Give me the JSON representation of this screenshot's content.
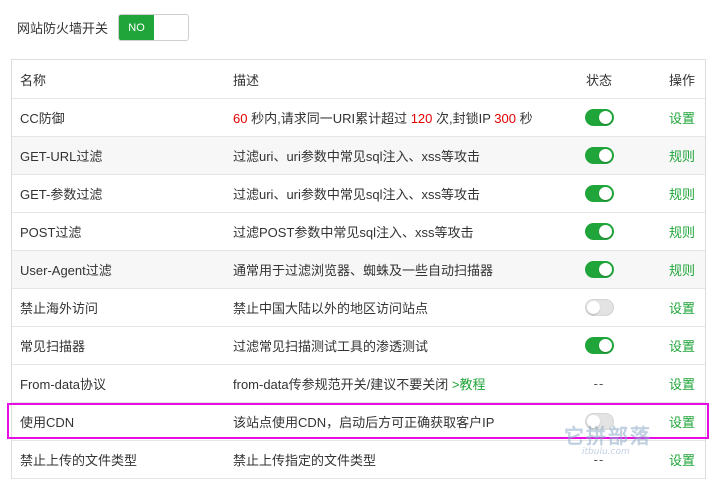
{
  "topbar": {
    "label": "网站防火墙开关",
    "switch_text": "NO"
  },
  "table": {
    "headers": {
      "name": "名称",
      "desc": "描述",
      "status": "状态",
      "action": "操作"
    },
    "rows": [
      {
        "name": "CC防御",
        "desc_parts": [
          "60",
          " 秒内,请求同一URI累计超过 ",
          "120",
          " 次,封锁IP ",
          "300",
          " 秒"
        ],
        "status": "on",
        "action": "设置"
      },
      {
        "name": "GET-URL过滤",
        "desc": "过滤uri、uri参数中常见sql注入、xss等攻击",
        "status": "on",
        "action": "规则"
      },
      {
        "name": "GET-参数过滤",
        "desc": "过滤uri、uri参数中常见sql注入、xss等攻击",
        "status": "on",
        "action": "规则"
      },
      {
        "name": "POST过滤",
        "desc": "过滤POST参数中常见sql注入、xss等攻击",
        "status": "on",
        "action": "规则"
      },
      {
        "name": "User-Agent过滤",
        "desc": "通常用于过滤浏览器、蜘蛛及一些自动扫描器",
        "status": "on",
        "action": "规则"
      },
      {
        "name": "禁止海外访问",
        "desc": "禁止中国大陆以外的地区访问站点",
        "status": "off",
        "action": "设置"
      },
      {
        "name": "常见扫描器",
        "desc": "过滤常见扫描测试工具的渗透测试",
        "status": "on",
        "action": "设置"
      },
      {
        "name": "From-data协议",
        "desc": "from-data传参规范开关/建议不要关闭",
        "desc_link": ">教程",
        "status_text": "--",
        "action": "设置"
      },
      {
        "name": "使用CDN",
        "desc": "该站点使用CDN，启动后方可正确获取客户IP",
        "status": "off",
        "action": "设置"
      },
      {
        "name": "禁止上传的文件类型",
        "desc": "禁止上传指定的文件类型",
        "status_text": "--",
        "action": "设置"
      }
    ]
  },
  "watermark": {
    "big": "它拼部落",
    "small": "itbulu.com"
  },
  "colors": {
    "accent": "#20a53a",
    "danger": "#e50000",
    "highlight": "#e40ee4"
  }
}
